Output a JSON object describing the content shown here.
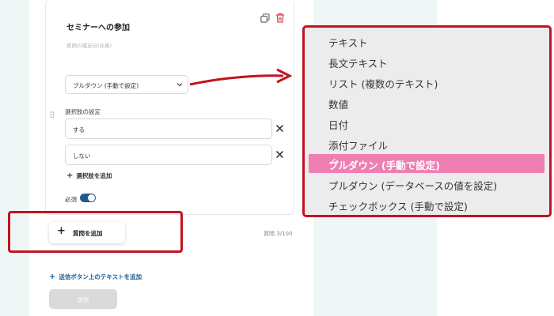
{
  "question": {
    "title": "セミナーへの参加",
    "description_placeholder": "質問の補足分(任意)",
    "type_select_value": "プルダウン (手動で設定)"
  },
  "options": {
    "heading": "選択肢の設定",
    "items": [
      "する",
      "しない"
    ],
    "add_label": "選択肢を追加"
  },
  "required": {
    "label": "必須",
    "enabled": true
  },
  "footer": {
    "add_question_label": "質問を追加",
    "question_count": "質問 3/100",
    "submit_text_link": "送信ボタン上のテキストを追加",
    "submit_label": "送信"
  },
  "dropdown": {
    "items": [
      "テキスト",
      "長文テキスト",
      "リスト (複数のテキスト)",
      "数値",
      "日付",
      "添付ファイル",
      "プルダウン (手動で設定)",
      "プルダウン (データベースの値を設定)",
      "チェックボックス (手動で設定)"
    ],
    "selected_index": 6,
    "check_glyph": "✓"
  },
  "colors": {
    "annotation_red": "#c4121f",
    "selected_pink": "#ef7fb3",
    "toggle_blue": "#1d5b8f"
  }
}
